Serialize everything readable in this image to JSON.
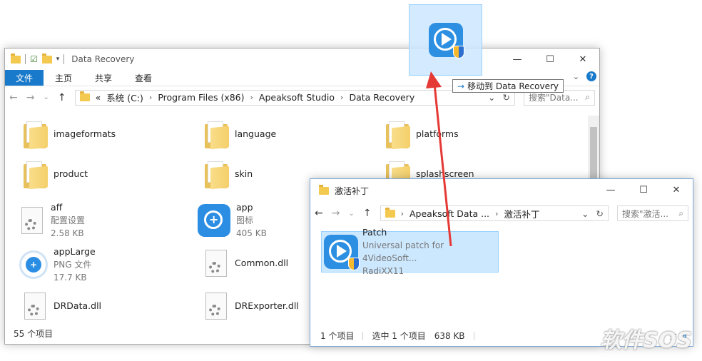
{
  "main_window": {
    "title": "Data Recovery",
    "ribbon_tabs": [
      "文件",
      "主页",
      "共享",
      "查看"
    ],
    "address": {
      "prefix": "«",
      "segments": [
        "系统 (C:)",
        "Program Files (x86)",
        "Apeaksoft Studio",
        "Data Recovery"
      ]
    },
    "search_placeholder": "搜索\"Data...",
    "items": [
      {
        "name": "imageformats"
      },
      {
        "name": "language"
      },
      {
        "name": "platforms"
      },
      {
        "name": "product"
      },
      {
        "name": "skin"
      },
      {
        "name": "splashscreen"
      },
      {
        "name": "aff",
        "type": "配置设置",
        "size": "2.58 KB"
      },
      {
        "name": "app",
        "type": "图标",
        "size": "405 KB"
      },
      {
        "name": "appLarge",
        "type": "PNG 文件",
        "size": "17.7 KB"
      },
      {
        "name": "Common.dll"
      },
      {
        "name": "DRData.dll"
      },
      {
        "name": "DRExporter.dll"
      }
    ],
    "status": "55 个项目"
  },
  "patch_window": {
    "title": "激活补丁",
    "address": {
      "segments": [
        "Apeaksoft Data ...",
        "激活补丁"
      ]
    },
    "search_placeholder": "搜索\"激活...",
    "item": {
      "name": "Patch",
      "desc": "Universal patch for 4VideoSoft...",
      "author": "RadiXX11"
    },
    "status_count": "1 个项目",
    "status_selected": "选中 1 个项目",
    "status_size": "638 KB"
  },
  "drag": {
    "tooltip_arrow": "→",
    "tooltip_text": "移动到 Data Recovery"
  },
  "watermark": "软件SOS",
  "colors": {
    "accent": "#1979ca",
    "selection": "#cce8ff",
    "arrow": "#e53935"
  }
}
